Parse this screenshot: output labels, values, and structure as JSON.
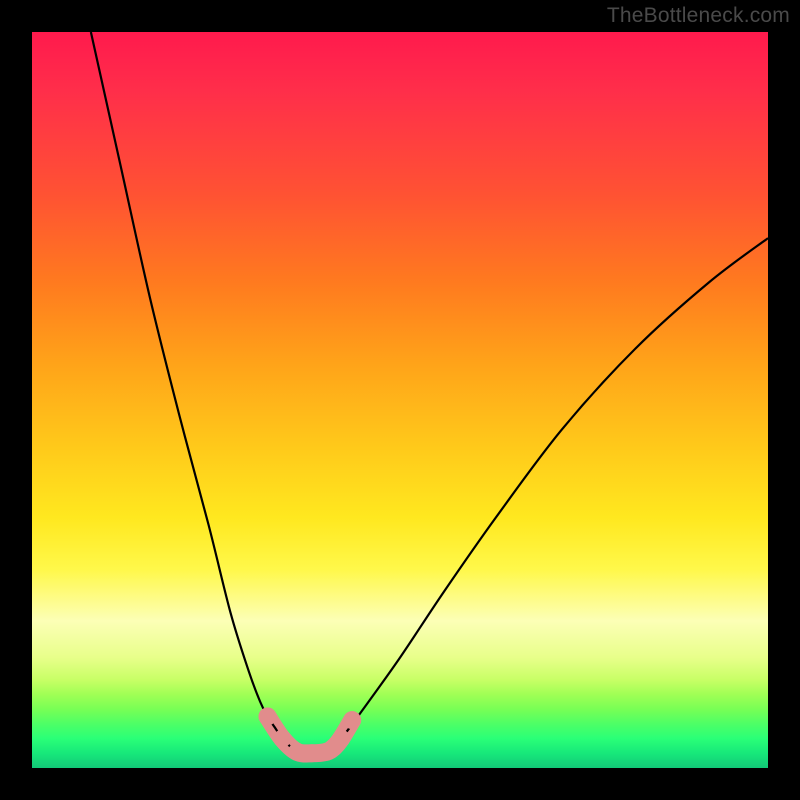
{
  "watermark": "TheBottleneck.com",
  "chart_data": {
    "type": "line",
    "title": "",
    "xlabel": "",
    "ylabel": "",
    "xlim": [
      0,
      100
    ],
    "ylim": [
      0,
      100
    ],
    "series": [
      {
        "name": "left-curve",
        "x": [
          8,
          12,
          16,
          20,
          24,
          27,
          29.5,
          31,
          32,
          33,
          34,
          35,
          36
        ],
        "y": [
          100,
          82,
          64,
          48,
          33,
          21,
          13,
          9,
          7,
          5.5,
          4,
          3,
          2.2
        ]
      },
      {
        "name": "right-curve",
        "x": [
          40,
          42,
          45,
          50,
          56,
          63,
          72,
          82,
          92,
          100
        ],
        "y": [
          2.2,
          4,
          8,
          15,
          24,
          34,
          46,
          57,
          66,
          72
        ]
      },
      {
        "name": "bottom",
        "x": [
          36,
          38,
          40
        ],
        "y": [
          2.2,
          2.0,
          2.2
        ]
      }
    ],
    "markers": {
      "name": "highlight-points",
      "x": [
        32,
        34,
        36,
        38,
        40,
        41,
        42,
        43.5
      ],
      "y": [
        7,
        4,
        2.2,
        2.0,
        2.2,
        2.8,
        4,
        6.5
      ]
    },
    "gradient_note": "background encodes bottleneck severity: red=high, green=low",
    "grid": false,
    "legend": false
  }
}
